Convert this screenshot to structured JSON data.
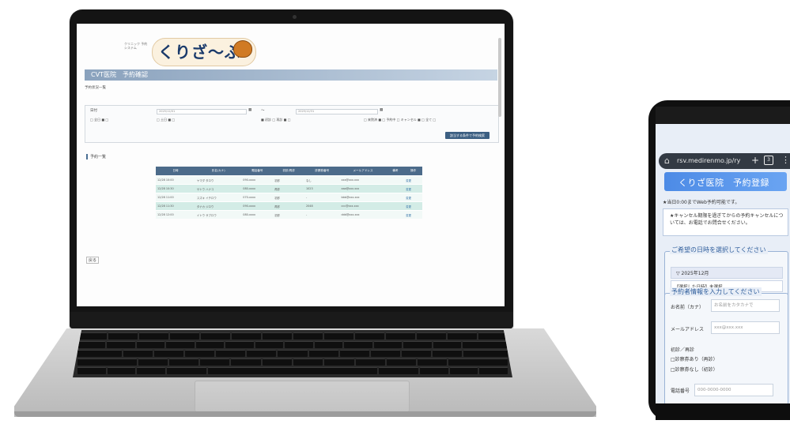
{
  "desktop": {
    "logo_tag": "クリニック 予約システム",
    "logo_text": "くりざ〜ぶ",
    "page_title": "CVT医院　予約確認",
    "sub_line1": "予約状況一覧",
    "sub_line2": "",
    "filter": {
      "label": "日付",
      "date_from": "2025/12/01",
      "date_to": "2025/12/31",
      "options_left": "□ 全日 ■ □",
      "options_mid": "■ 初診 □ 再診 ■ □",
      "options_right": "□ 来院済 ■ □ 予約中 □ キャンセル ■ □ 全て □",
      "search_label": "該当する条件で予約検索"
    },
    "list_title": "予約一覧",
    "table": {
      "headers": [
        "日時",
        "氏名(カナ)",
        "電話番号",
        "初診/再診",
        "診察券番号",
        "メールアドレス",
        "備考",
        "操作"
      ],
      "rows": [
        [
          "12/28 10:00",
          "ヤマダ タロウ",
          "090-xxxx",
          "初診",
          "なし",
          "xxx@xxx.xxx",
          "",
          "変更"
        ],
        [
          "12/28 10:30",
          "サトウ ハナコ",
          "080-xxxx",
          "再診",
          "1023",
          "aaa@xxx.xxx",
          "",
          "変更"
        ],
        [
          "12/28 11:00",
          "スズキ イチロウ",
          "070-xxxx",
          "初診",
          "-",
          "bbb@xxx.xxx",
          "",
          "変更"
        ],
        [
          "12/28 11:30",
          "タナカ ジロウ",
          "090-xxxx",
          "再診",
          "2048",
          "ccc@xxx.xxx",
          "",
          "変更"
        ],
        [
          "12/28 12:00",
          "イトウ サブロウ",
          "080-xxxx",
          "初診",
          "-",
          "ddd@xxx.xxx",
          "",
          "変更"
        ]
      ]
    },
    "back_label": "戻る"
  },
  "phone": {
    "url": "rsv.medirenmo.jp/ry",
    "tab_count": "3",
    "header_title": "くりざ医院　予約登録",
    "notice": "★当日0:00までWeb予約可能です。",
    "cancel_text": "★キャンセル期限を過ぎてからの予約キャンセルについては、お電話でお問合せください。",
    "section1_legend": "ご希望の日時を選択してください",
    "month_label": "▽ 2025年12月",
    "selected_date": "【選択した日時】未選択",
    "section2_legend": "予約者情報を入力してください",
    "name_label": "お名前（カナ）",
    "name_placeholder": "お名前をカタカナで",
    "email_label": "メールアドレス",
    "email_placeholder": "xxx@xxx.xxx",
    "visit_label": "初診／再診",
    "visit_option1": "□診察券あり（再診）",
    "visit_option2": "□診察券なし（初診）",
    "phone_label": "電話番号",
    "phone_placeholder": "000-0000-0000"
  }
}
